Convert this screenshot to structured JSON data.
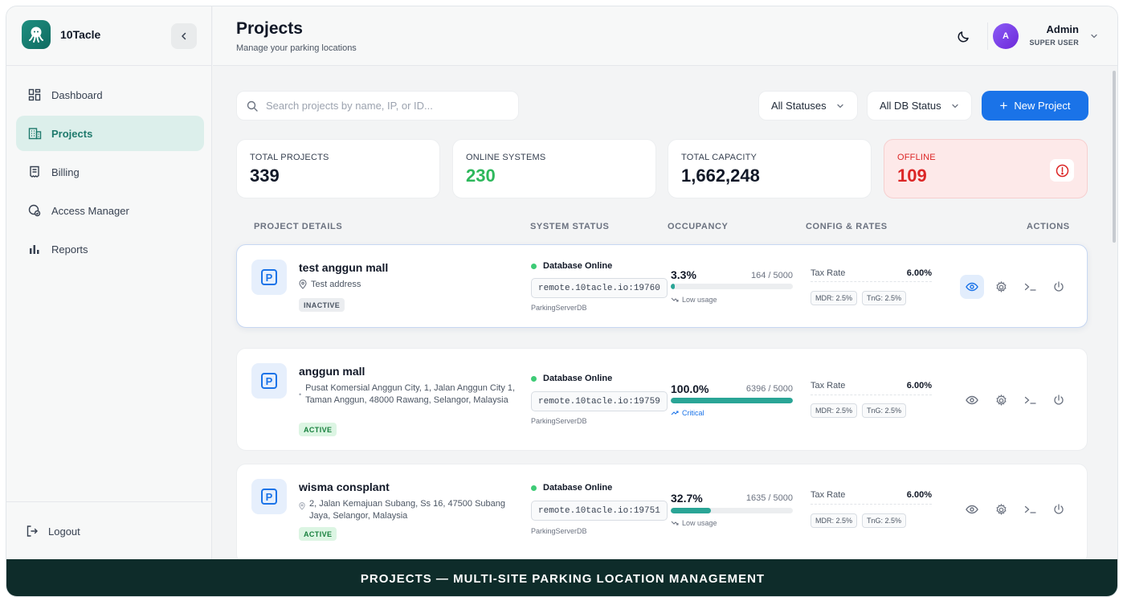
{
  "app": {
    "name": "10Tacle"
  },
  "sidebar": {
    "items": [
      {
        "label": "Dashboard",
        "icon": "dashboard-icon"
      },
      {
        "label": "Projects",
        "icon": "building-icon",
        "active": true
      },
      {
        "label": "Billing",
        "icon": "receipt-icon"
      },
      {
        "label": "Access Manager",
        "icon": "access-icon"
      },
      {
        "label": "Reports",
        "icon": "bar-chart-icon"
      }
    ],
    "logout_label": "Logout"
  },
  "header": {
    "title": "Projects",
    "subtitle": "Manage your parking locations",
    "user": {
      "initial": "A",
      "name": "Admin",
      "role": "SUPER USER"
    }
  },
  "toolbar": {
    "search_placeholder": "Search projects by name, IP, or ID...",
    "status_filter": "All Statuses",
    "db_filter": "All DB Status",
    "new_button": "New Project"
  },
  "stats": {
    "total_projects": {
      "label": "TOTAL PROJECTS",
      "value": "339"
    },
    "online_systems": {
      "label": "ONLINE SYSTEMS",
      "value": "230"
    },
    "total_capacity": {
      "label": "TOTAL CAPACITY",
      "value": "1,662,248"
    },
    "offline": {
      "label": "OFFLINE",
      "value": "109"
    }
  },
  "columns": {
    "details": "PROJECT DETAILS",
    "status": "SYSTEM STATUS",
    "occupancy": "OCCUPANCY",
    "config": "CONFIG & RATES",
    "actions": "ACTIONS"
  },
  "projects": [
    {
      "name": "test anggun mall",
      "address": "Test address",
      "status": "INACTIVE",
      "db_status": "Database Online",
      "endpoint": "remote.10tacle.io:19760",
      "db_name": "ParkingServerDB",
      "occupancy_pct": "3.3%",
      "occupancy_fraction": 0.033,
      "occupancy_count": "164 / 5000",
      "usage_note": "Low usage",
      "tax_label": "Tax Rate",
      "tax_rate": "6.00%",
      "mdr": "MDR: 2.5%",
      "tng": "TnG: 2.5%"
    },
    {
      "name": "anggun mall",
      "address": "Pusat Komersial Anggun City, 1, Jalan Anggun City 1, Taman Anggun, 48000 Rawang, Selangor, Malaysia",
      "status": "ACTIVE",
      "db_status": "Database Online",
      "endpoint": "remote.10tacle.io:19759",
      "db_name": "ParkingServerDB",
      "occupancy_pct": "100.0%",
      "occupancy_fraction": 1.0,
      "occupancy_count": "6396 / 5000",
      "usage_note": "Critical",
      "tax_label": "Tax Rate",
      "tax_rate": "6.00%",
      "mdr": "MDR: 2.5%",
      "tng": "TnG: 2.5%"
    },
    {
      "name": "wisma consplant",
      "address": "2, Jalan Kemajuan Subang, Ss 16, 47500 Subang Jaya, Selangor, Malaysia",
      "status": "ACTIVE",
      "db_status": "Database Online",
      "endpoint": "remote.10tacle.io:19751",
      "db_name": "ParkingServerDB",
      "occupancy_pct": "32.7%",
      "occupancy_fraction": 0.327,
      "occupancy_count": "1635 / 5000",
      "usage_note": "Low usage",
      "tax_label": "Tax Rate",
      "tax_rate": "6.00%",
      "mdr": "MDR: 2.5%",
      "tng": "TnG: 2.5%"
    }
  ],
  "banner": "PROJECTS — MULTI-SITE PARKING LOCATION MANAGEMENT",
  "colors": {
    "brand": "#1f8f80",
    "primary": "#1a73e8",
    "online": "#3ecb76",
    "offline": "#dc2626",
    "occupancy_bar": "#2aa596"
  }
}
